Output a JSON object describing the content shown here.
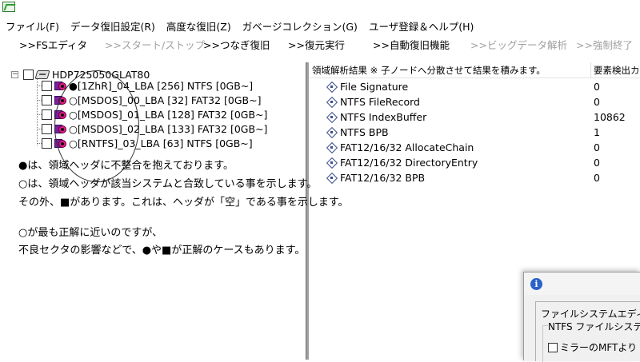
{
  "menu": [
    "ファイル(F)",
    "データ復旧設定(R)",
    "高度な復旧(Z)",
    "ガベージコレクション(G)",
    "ユーザ登録＆ヘルプ(H)"
  ],
  "toolbar": [
    {
      "label": ">>FSエディタ",
      "enabled": true
    },
    {
      "label": ">>スタート/ストップ",
      "enabled": false
    },
    {
      "label": ">>つなぎ復旧",
      "enabled": true
    },
    {
      "label": ">>復元実行",
      "enabled": true
    },
    {
      "label": ">>自動復旧機能",
      "enabled": true
    },
    {
      "label": ">>ビッグデータ解析",
      "enabled": false
    },
    {
      "label": ">>強制終了",
      "enabled": false
    }
  ],
  "tree": {
    "root_label": "HDP725050GLAT80",
    "expander": "−",
    "partitions": [
      {
        "label": "●[1ZhR]_04_LBA [256] NTFS [0GB~]"
      },
      {
        "label": "○[MSDOS]_00_LBA [32] FAT32 [0GB~]"
      },
      {
        "label": "○[MSDOS]_01_LBA [128] FAT32 [0GB~]"
      },
      {
        "label": "○[MSDOS]_02_LBA [133] FAT32 [0GB~]"
      },
      {
        "label": "○[RNTFS]_03_LBA [63] NTFS [0GB~]"
      }
    ]
  },
  "notes": [
    "●は、領域ヘッダに不整合を抱えております。",
    "○は、領域ヘッダが該当システムと合致している事を示します。",
    "その外、■があります。これは、ヘッダが「空」である事を示します。",
    "○が最も正解に近いのですが、",
    "不良セクタの影響などで、●や■が正解のケースもあります。"
  ],
  "results": {
    "header_left": "領域解析結果 ※ 子ノードへ分散させて結果を積みます。",
    "header_right": "要素検出カ",
    "rows": [
      {
        "name": "File Signature",
        "value": "0"
      },
      {
        "name": "NTFS FileRecord",
        "value": "0"
      },
      {
        "name": "NTFS IndexBuffer",
        "value": "10862"
      },
      {
        "name": "NTFS BPB",
        "value": "1"
      },
      {
        "name": "FAT12/16/32 AllocateChain",
        "value": "0"
      },
      {
        "name": "FAT12/16/32 DirectoryEntry",
        "value": "0"
      },
      {
        "name": "FAT12/16/32 BPB",
        "value": "0"
      }
    ]
  },
  "dialog": {
    "info_glyph": "i",
    "title": "ファイルシステムエディタ メ",
    "group_label": "NTFS ファイルシステ",
    "checkbox_label": "ミラーのMFTより"
  }
}
